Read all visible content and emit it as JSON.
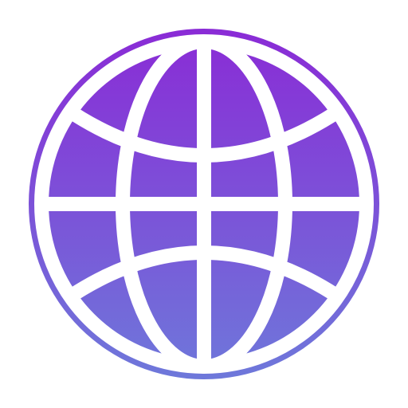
{
  "icon": {
    "name": "globe-icon",
    "colors": {
      "gradient_top": "#8A2BD6",
      "gradient_bottom": "#6E78DA",
      "grid_lines": "#FFFFFF",
      "background": "#FFFFFF"
    }
  }
}
